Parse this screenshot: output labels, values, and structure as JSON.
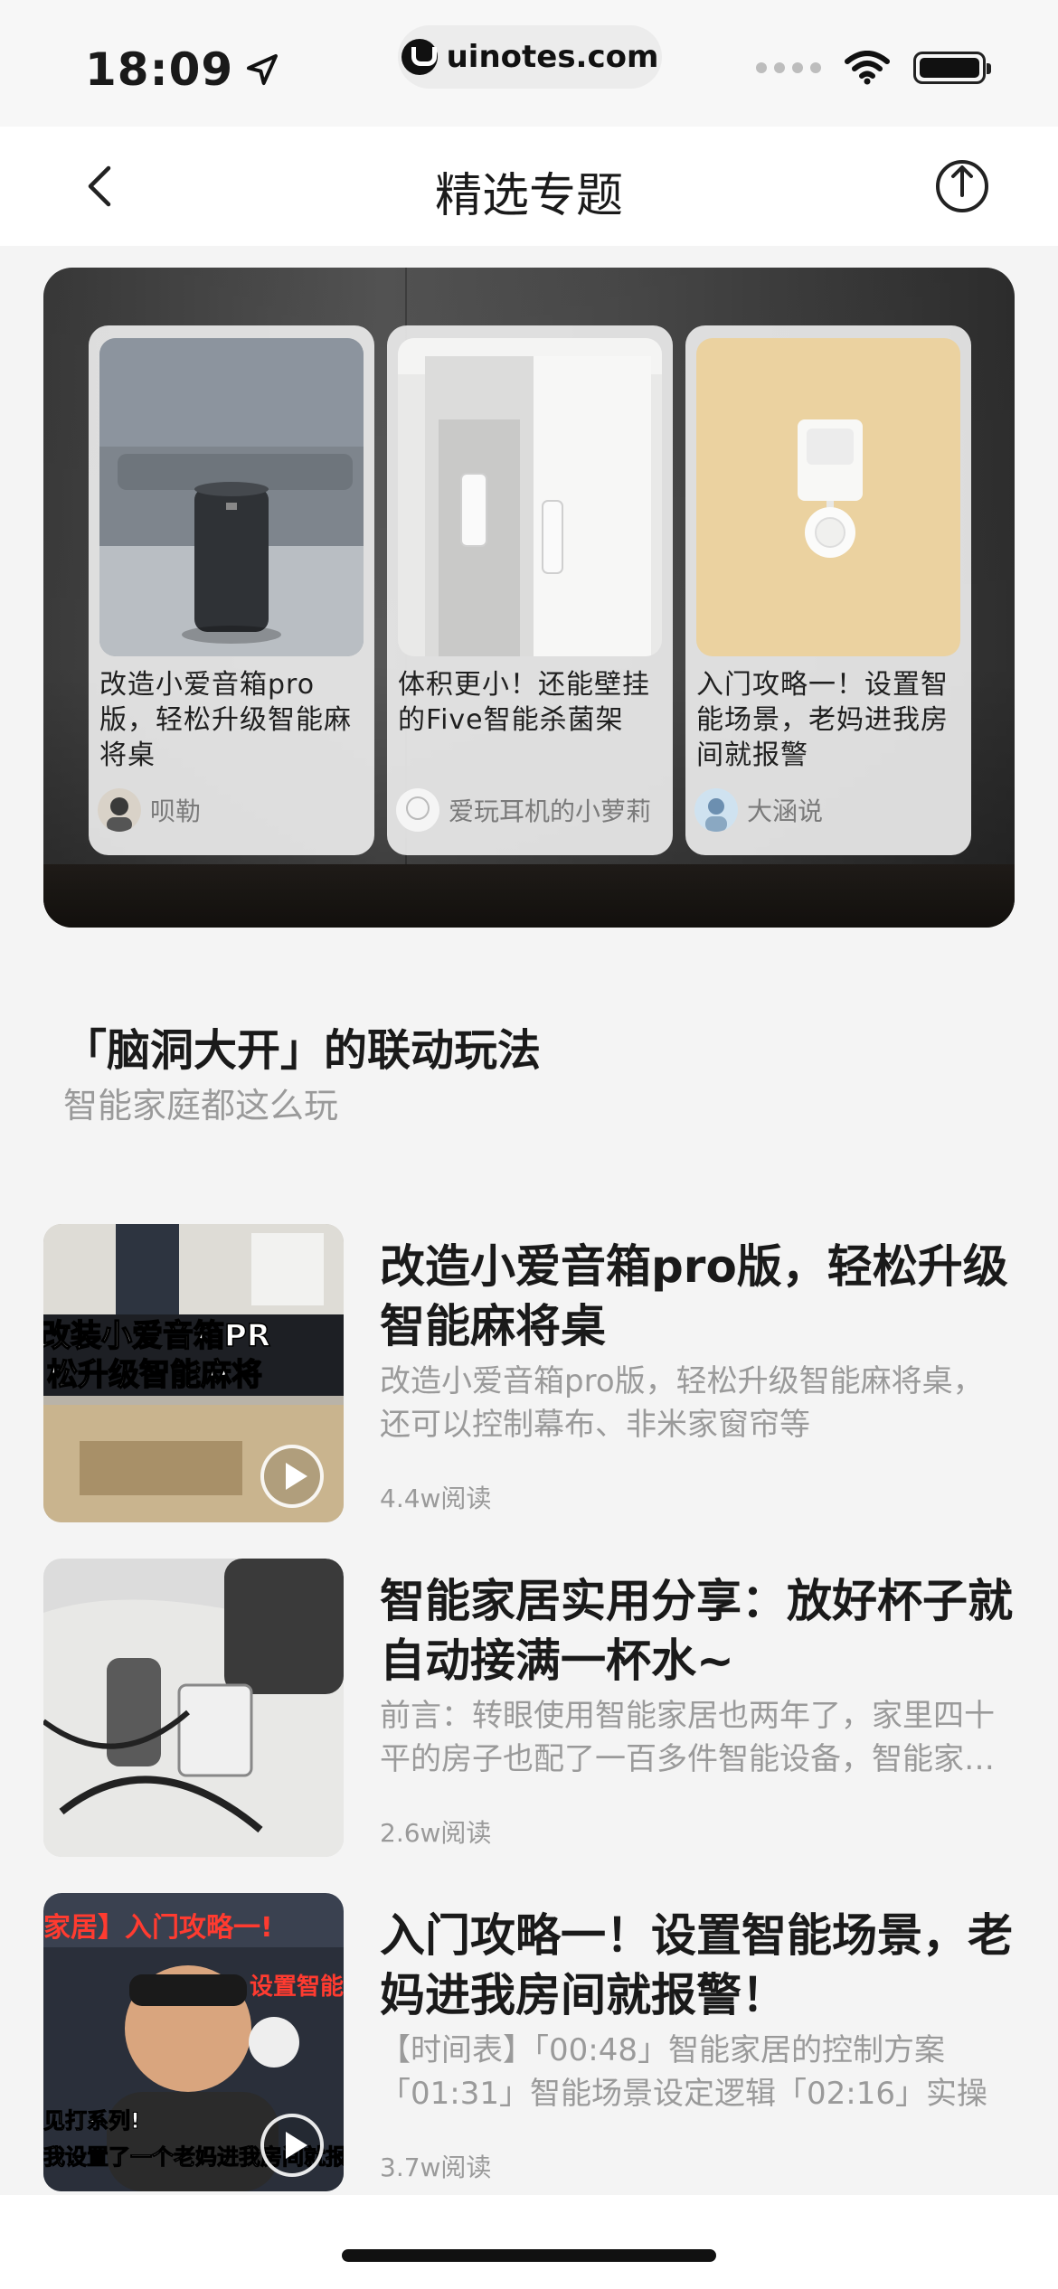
{
  "status_bar": {
    "time": "18:09",
    "url": "uinotes.com"
  },
  "nav": {
    "title": "精选专题"
  },
  "banner_cards": [
    {
      "title": "改造小爱音箱pro版，轻松升级智能麻将桌",
      "author": "呗勒"
    },
    {
      "title": "体积更小！还能壁挂的Five智能杀菌架",
      "author": "爱玩耳机的小萝莉"
    },
    {
      "title": "入门攻略一！设置智能场景，老妈进我房间就报警",
      "author": "大涵说"
    }
  ],
  "section": {
    "title": "「脑洞大开」的联动玩法",
    "subtitle": "智能家庭都这么玩"
  },
  "items": [
    {
      "title": "改造小爱音箱pro版，轻松升级智能麻将桌",
      "desc": "改造小爱音箱pro版，轻松升级智能麻将桌，还可以控制幕布、非米家窗帘等",
      "reads": "4.4w阅读",
      "thumb_text_1": "改装小爱音箱PR",
      "thumb_text_2": "松升级智能麻将"
    },
    {
      "title": "智能家居实用分享：放好杯子就自动接满一杯水~",
      "desc": "前言：转眼使用智能家居也两年了，家里四十平的房子也配了一百多件智能设备，智能家居的",
      "reads": "2.6w阅读"
    },
    {
      "title": "入门攻略一！设置智能场景，老妈进我房间就报警！",
      "desc": "【时间表】「00:48」智能家居的控制方案「01:31」智能场景设定逻辑「02:16」实操",
      "reads": "3.7w阅读",
      "thumb_text_1": "家居】入门攻略一!",
      "thumb_text_2": "设置智能",
      "thumb_text_3": "见打系列!",
      "thumb_text_4": "我设置了一个老妈进我房间就报"
    }
  ]
}
